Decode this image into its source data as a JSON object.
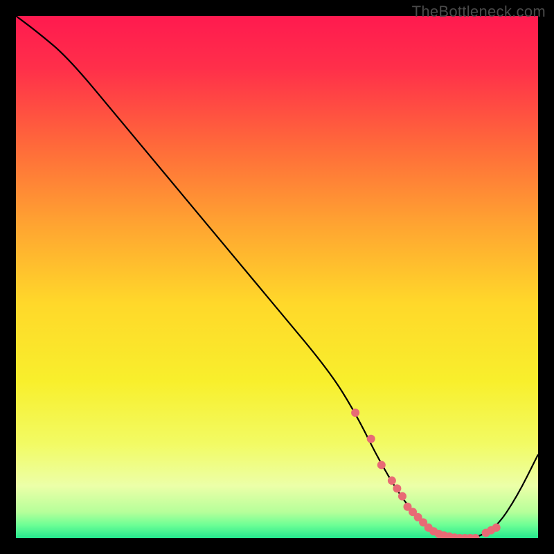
{
  "watermark": "TheBottleneck.com",
  "chart_data": {
    "type": "line",
    "title": "",
    "xlabel": "",
    "ylabel": "",
    "xlim": [
      0,
      100
    ],
    "ylim": [
      0,
      100
    ],
    "x": [
      0,
      4,
      10,
      20,
      30,
      40,
      50,
      60,
      65,
      70,
      75,
      80,
      85,
      88,
      92,
      96,
      100
    ],
    "values": [
      100,
      97,
      92,
      80,
      68,
      56,
      44,
      32,
      24,
      14,
      6,
      1,
      0,
      0,
      2,
      8,
      16
    ],
    "marker_points": {
      "x": [
        65,
        68,
        70,
        72,
        73,
        74,
        75,
        76,
        77,
        78,
        79,
        80,
        81,
        82,
        83,
        84,
        85,
        86,
        87,
        88,
        90,
        91,
        92
      ],
      "values": [
        24,
        19,
        14,
        11,
        9.5,
        8,
        6,
        5,
        4,
        3,
        2,
        1.3,
        0.8,
        0.5,
        0.3,
        0.1,
        0,
        0,
        0,
        0,
        1,
        1.5,
        2
      ]
    },
    "gradient_stops": [
      {
        "offset": 0.0,
        "color": "#ff1a4f"
      },
      {
        "offset": 0.1,
        "color": "#ff2f4a"
      },
      {
        "offset": 0.25,
        "color": "#ff6a3a"
      },
      {
        "offset": 0.4,
        "color": "#ffa431"
      },
      {
        "offset": 0.55,
        "color": "#ffd82a"
      },
      {
        "offset": 0.7,
        "color": "#f8ef2c"
      },
      {
        "offset": 0.82,
        "color": "#f2fb64"
      },
      {
        "offset": 0.9,
        "color": "#ecffa8"
      },
      {
        "offset": 0.95,
        "color": "#b6ff9a"
      },
      {
        "offset": 0.975,
        "color": "#6dff95"
      },
      {
        "offset": 1.0,
        "color": "#25e78e"
      }
    ],
    "line_color": "#000000",
    "marker_color": "#e86a75",
    "marker_radius": 6
  }
}
